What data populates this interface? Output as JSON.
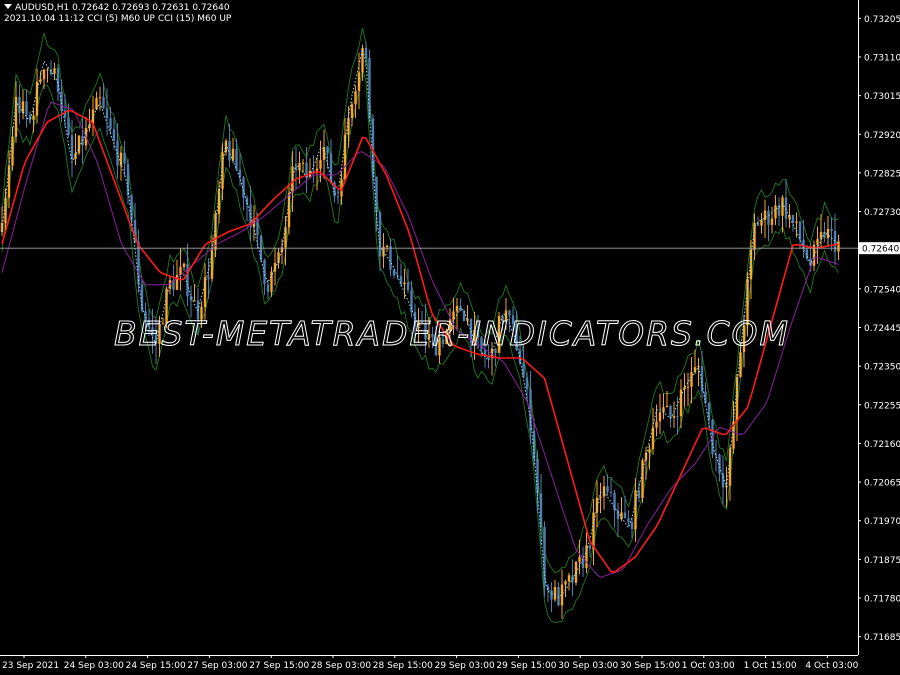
{
  "header": {
    "symbol_line": "AUDUSD,H1  0.72642 0.72693 0.72631 0.72640",
    "indicator_line": "2021.10.04 11:12  CCI (5) M60 UP  CCI (15) M60 UP"
  },
  "watermark": "BEST-METATRADER-INDICATORS.COM",
  "current_price_label": "0.72640",
  "colors": {
    "background": "#000000",
    "bull_candle": "#f5a623",
    "bear_candle": "#4f7fb0",
    "red_ma": "#ff1a1a",
    "purple_ma": "#8b1f9e",
    "green_envelope": "#1f7a1f",
    "cyan_dots": "#8fe3ff",
    "price_line": "#a8a8a8",
    "axis_text": "#ffffff"
  },
  "chart_data": {
    "type": "line",
    "title": "",
    "xlabel": "",
    "ylabel": "",
    "ylim": [
      0.7164,
      0.7325
    ],
    "y_ticks": [
      "0.73205",
      "0.73110",
      "0.73015",
      "0.72920",
      "0.72825",
      "0.72730",
      "0.72640",
      "0.72540",
      "0.72445",
      "0.72350",
      "0.72255",
      "0.72160",
      "0.72065",
      "0.71970",
      "0.71875",
      "0.71780",
      "0.71685"
    ],
    "x_ticks": [
      "23 Sep 2021",
      "24 Sep 03:00",
      "24 Sep 15:00",
      "27 Sep 03:00",
      "27 Sep 15:00",
      "28 Sep 03:00",
      "28 Sep 15:00",
      "29 Sep 03:00",
      "29 Sep 15:00",
      "30 Sep 03:00",
      "30 Sep 15:00",
      "1 Oct 03:00",
      "1 Oct 15:00",
      "4 Oct 03:00"
    ],
    "current_price": 0.7264,
    "legend": "none",
    "grid": false,
    "series": [
      {
        "kind": "price",
        "values": [
          0.7268,
          0.73,
          0.7295,
          0.731,
          0.7305,
          0.7285,
          0.7292,
          0.73,
          0.729,
          0.728,
          0.725,
          0.724,
          0.7255,
          0.7258,
          0.7248,
          0.7261,
          0.729,
          0.7282,
          0.727,
          0.7255,
          0.7262,
          0.7285,
          0.7281,
          0.729,
          0.7275,
          0.73,
          0.7315,
          0.7265,
          0.726,
          0.7252,
          0.7244,
          0.724,
          0.7244,
          0.725,
          0.724,
          0.7236,
          0.7249,
          0.724,
          0.722,
          0.718,
          0.7178,
          0.7183,
          0.719,
          0.7205,
          0.72,
          0.7195,
          0.721,
          0.7225,
          0.7222,
          0.723,
          0.7235,
          0.7215,
          0.7205,
          0.724,
          0.727,
          0.7272,
          0.7275,
          0.7268,
          0.726,
          0.7268,
          0.7265
        ]
      },
      {
        "kind": "red_ma",
        "values": [
          0.7265,
          0.7285,
          0.7295,
          0.7298,
          0.7295,
          0.728,
          0.7265,
          0.7258,
          0.7256,
          0.7265,
          0.7268,
          0.727,
          0.7276,
          0.7281,
          0.7283,
          0.7278,
          0.7292,
          0.7282,
          0.7268,
          0.7248,
          0.724,
          0.7238,
          0.7237,
          0.7237,
          0.7232,
          0.7212,
          0.7192,
          0.7184,
          0.7188,
          0.7196,
          0.7208,
          0.722,
          0.7218,
          0.7225,
          0.7245,
          0.7265,
          0.7264,
          0.7265
        ]
      },
      {
        "kind": "purple_ma",
        "values": [
          0.7258,
          0.728,
          0.73,
          0.7298,
          0.7285,
          0.7265,
          0.7255,
          0.7255,
          0.726,
          0.7265,
          0.7268,
          0.7272,
          0.7277,
          0.7282,
          0.7282,
          0.7288,
          0.7284,
          0.7272,
          0.7256,
          0.7244,
          0.724,
          0.7236,
          0.7226,
          0.7208,
          0.719,
          0.7183,
          0.7185,
          0.7196,
          0.7205,
          0.7211,
          0.722,
          0.7218,
          0.7226,
          0.7245,
          0.7262,
          0.726
        ]
      }
    ]
  }
}
